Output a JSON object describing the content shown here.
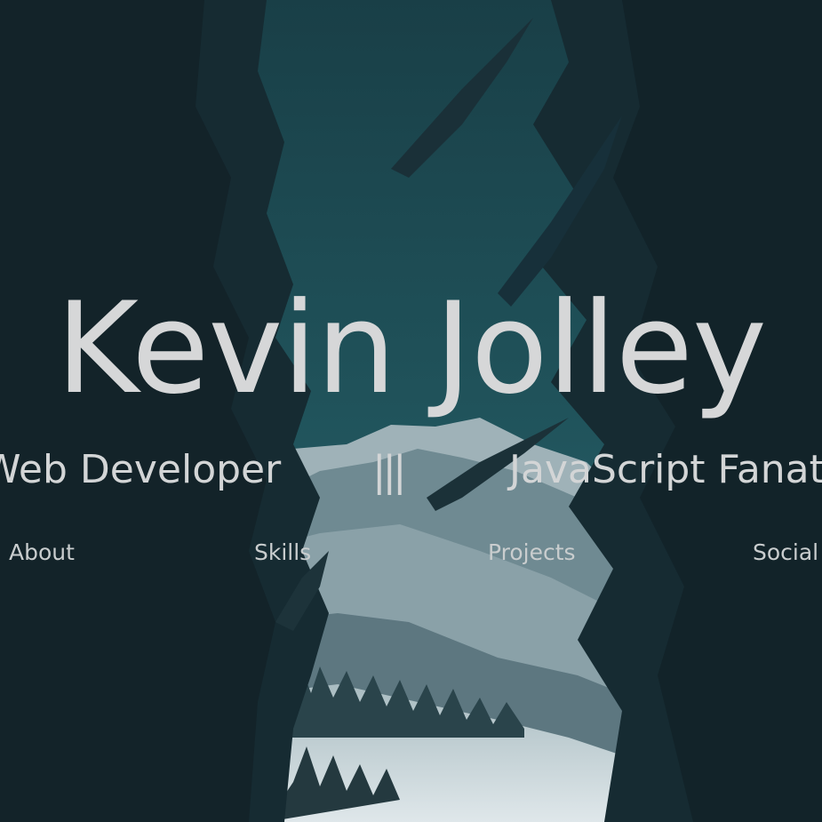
{
  "hero": {
    "name": "Kevin Jolley",
    "tagline_left": "Web Developer",
    "tagline_separator": "|||",
    "tagline_right": "JavaScript Fanatic"
  },
  "nav": {
    "items": [
      {
        "label": "About"
      },
      {
        "label": "Skills"
      },
      {
        "label": "Projects"
      },
      {
        "label": "Social"
      }
    ]
  },
  "colors": {
    "text": "#d6d7d8",
    "background": "#16313a",
    "sky": "#1f5058"
  }
}
